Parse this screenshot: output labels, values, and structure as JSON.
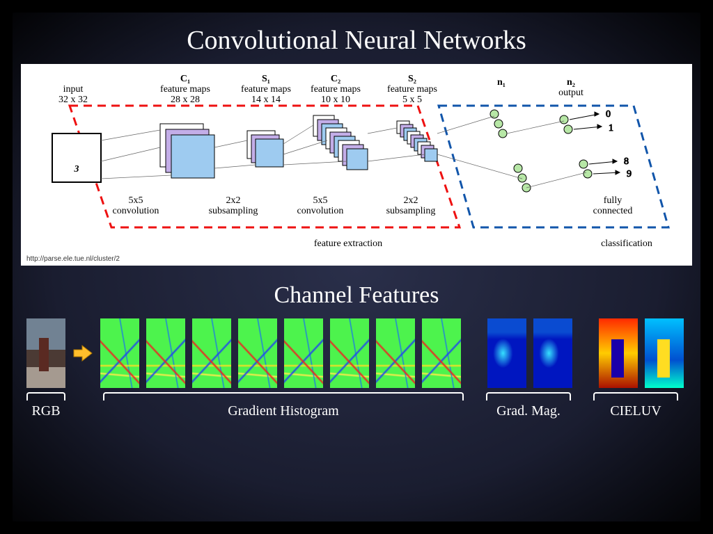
{
  "title": "Convolutional Neural Networks",
  "subtitle": "Channel Features",
  "citation": "http://parse.ele.tue.nl/cluster/2",
  "cnn": {
    "input_label": "input",
    "input_size": "32 x 32",
    "input_glyph": "3",
    "layers": {
      "c1": {
        "name": "C₁",
        "sub": "feature maps",
        "size": "28 x 28"
      },
      "s1": {
        "name": "S₁",
        "sub": "feature maps",
        "size": "14 x 14"
      },
      "c2": {
        "name": "C₂",
        "sub": "feature maps",
        "size": "10 x 10"
      },
      "s2": {
        "name": "S₂",
        "sub": "feature maps",
        "size": "5 x 5"
      },
      "n1": {
        "name": "n₁"
      },
      "n2": {
        "name": "n₂",
        "sub": "output"
      }
    },
    "ops": {
      "conv1": "5x5\nconvolution",
      "sub1": "2x2\nsubsampling",
      "conv2": "5x5\nconvolution",
      "sub2": "2x2\nsubsampling",
      "fc": "fully\nconnected"
    },
    "outputs": [
      "0",
      "1",
      "8",
      "9"
    ],
    "stage_feature": "feature extraction",
    "stage_class": "classification"
  },
  "channels": {
    "rgb": "RGB",
    "grad": "Gradient Histogram",
    "mag": "Grad. Mag.",
    "luv": "CIELUV"
  }
}
